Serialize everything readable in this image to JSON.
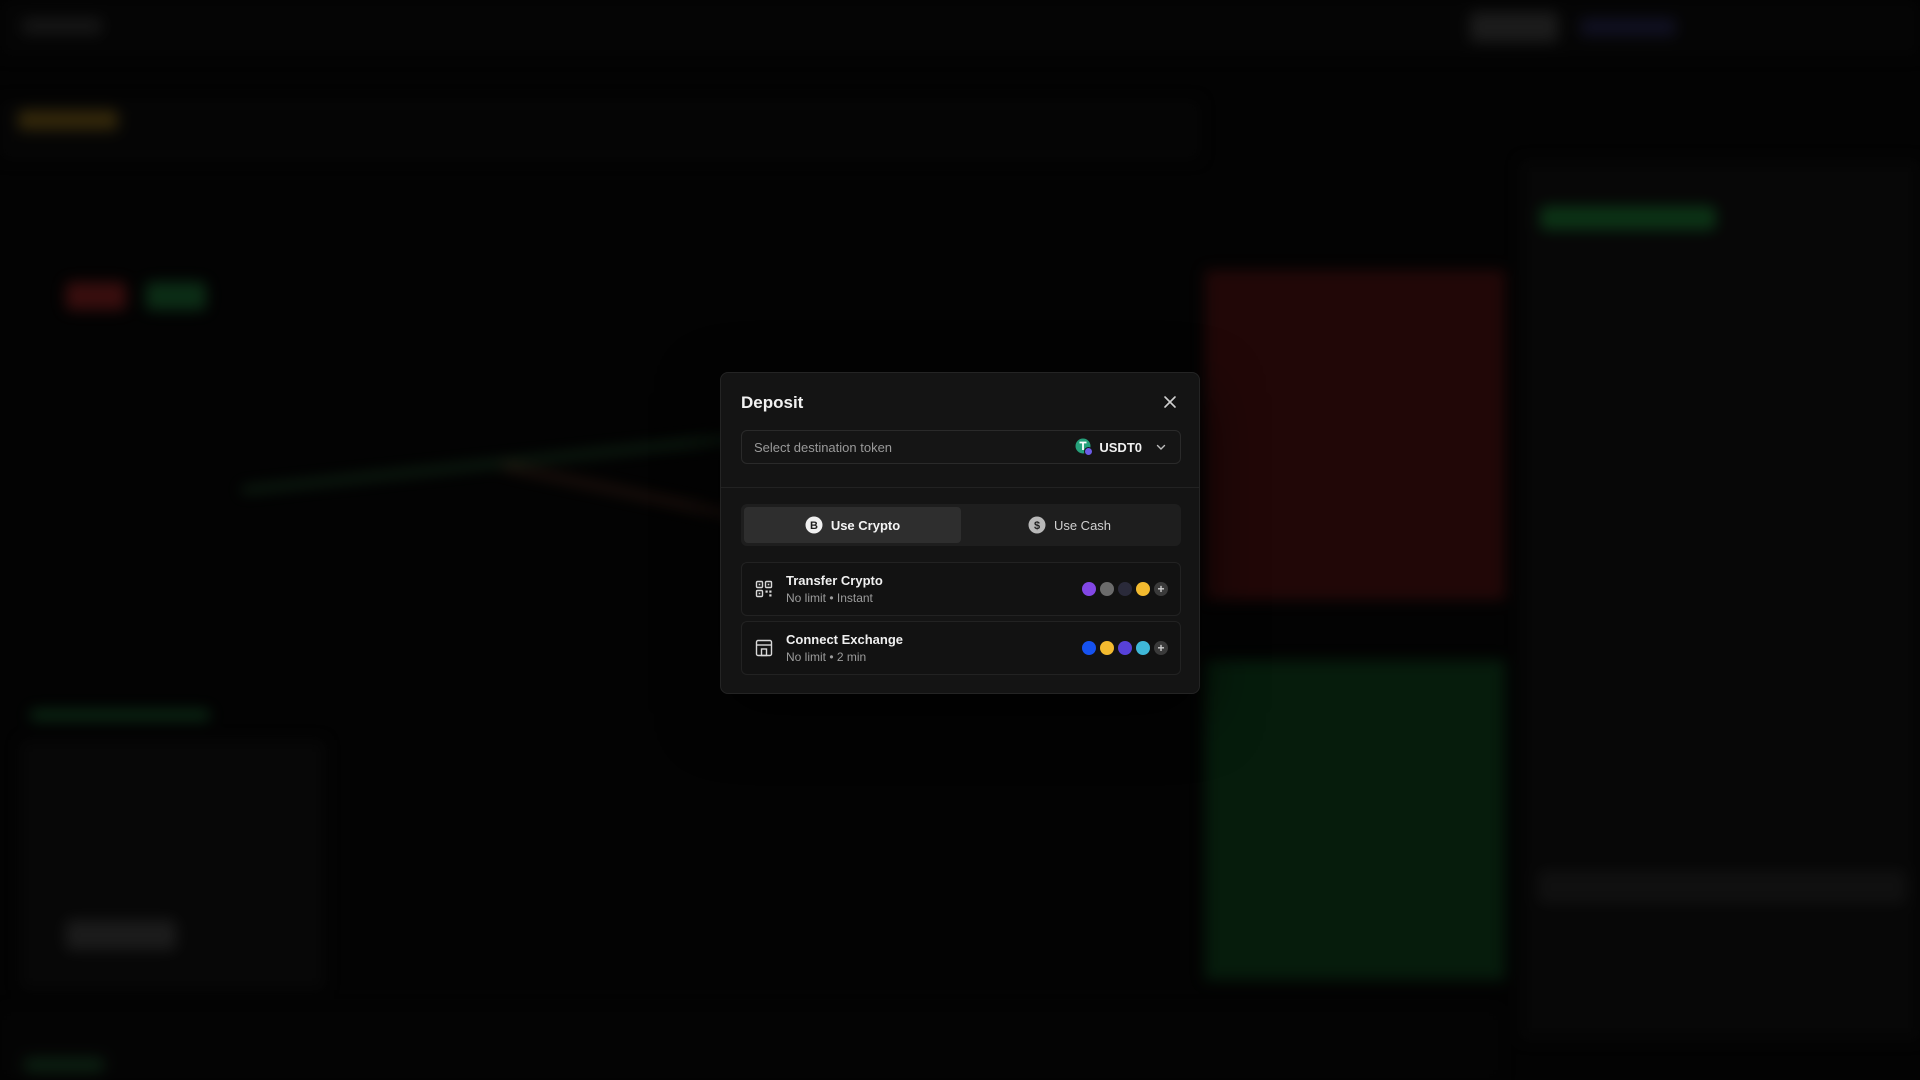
{
  "modal": {
    "title": "Deposit",
    "close_icon": "close-icon",
    "token_select": {
      "label": "Select destination token",
      "value": "USDT0",
      "icon": "usdt0-token-icon",
      "chevron": "chevron-down-icon"
    },
    "tabs": [
      {
        "label": "Use Crypto",
        "icon": "bitcoin-icon",
        "active": true
      },
      {
        "label": "Use Cash",
        "icon": "dollar-icon",
        "active": false
      }
    ],
    "options": [
      {
        "title": "Transfer Crypto",
        "subtitle": "No limit • Instant",
        "icon": "qr-code-icon",
        "coins": [
          {
            "name": "polygon",
            "color": "#8247e5"
          },
          {
            "name": "ethereum",
            "color": "#6b6b6b"
          },
          {
            "name": "solana",
            "color": "#2a2a3a"
          },
          {
            "name": "bnb",
            "color": "#f3ba2f"
          }
        ]
      },
      {
        "title": "Connect Exchange",
        "subtitle": "No limit • 2 min",
        "icon": "exchange-building-icon",
        "coins": [
          {
            "name": "coinbase",
            "color": "#1652f0"
          },
          {
            "name": "binance",
            "color": "#f3ba2f"
          },
          {
            "name": "kraken",
            "color": "#5741d9"
          },
          {
            "name": "okx",
            "color": "#3fb8d8"
          }
        ]
      }
    ]
  },
  "colors": {
    "modal_bg": "#141414",
    "accent_green": "#26a17b"
  }
}
